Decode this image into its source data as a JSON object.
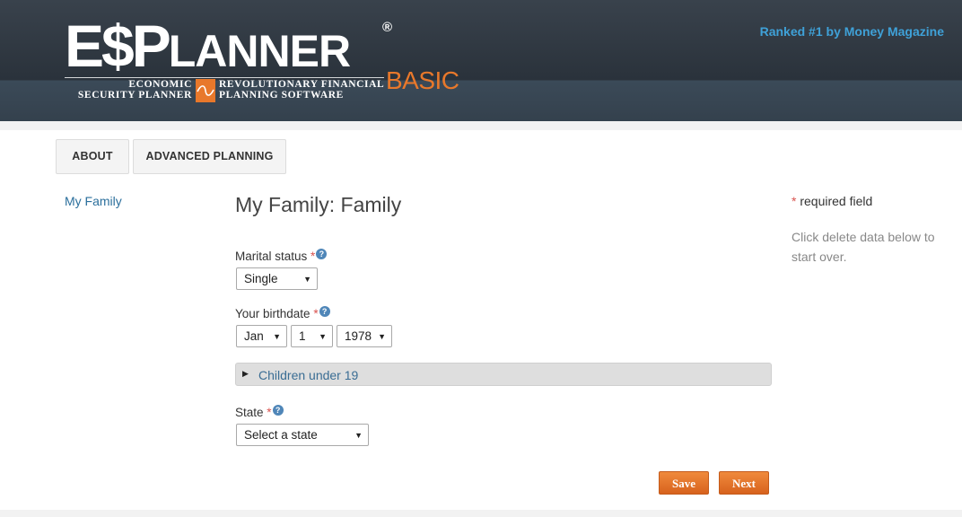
{
  "header": {
    "logo": {
      "main_part1": "E$P",
      "main_part2": "LANNER",
      "registered": "®",
      "edition": "BASIC",
      "tagline_left_1": "ECONOMIC",
      "tagline_left_2": "SECURITY PLANNER",
      "tagline_right_1": "REVOLUTIONARY FINANCIAL",
      "tagline_right_2": "PLANNING SOFTWARE"
    },
    "ranked": "Ranked #1 by Money Magazine"
  },
  "tabs": [
    {
      "label": "ABOUT"
    },
    {
      "label": "ADVANCED PLANNING"
    }
  ],
  "sidebar": {
    "link": "My Family"
  },
  "page": {
    "title": "My Family: Family"
  },
  "form": {
    "marital_status": {
      "label": "Marital status",
      "value": "Single"
    },
    "birthdate": {
      "label": "Your birthdate",
      "month": "Jan",
      "day": "1",
      "year": "1978"
    },
    "children": {
      "label": "Children under 19"
    },
    "state": {
      "label": "State",
      "value": "Select a state"
    },
    "required_mark": "*",
    "help_glyph": "?"
  },
  "buttons": {
    "save": "Save",
    "next": "Next"
  },
  "notes": {
    "required": "required field",
    "delete_hint": "Click delete data below to start over."
  },
  "colors": {
    "header_bg": "#2f3841",
    "accent_orange": "#e8782b",
    "link_blue": "#2b6f9c",
    "ranked_blue": "#3fa1d8",
    "required_red": "#d9534f"
  }
}
